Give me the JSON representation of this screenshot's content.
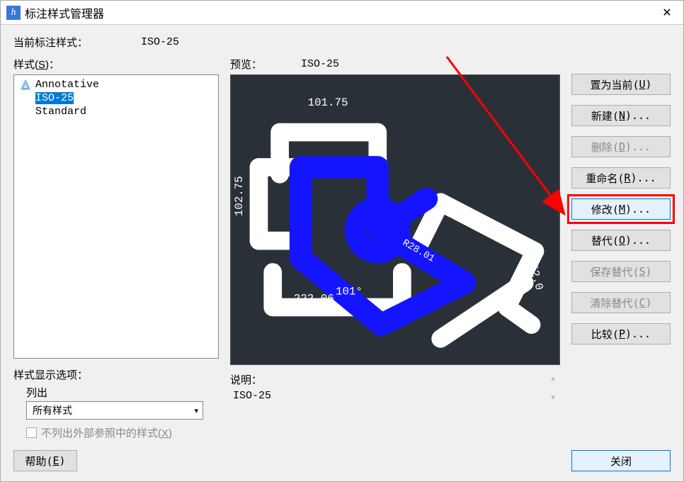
{
  "window": {
    "title": "标注样式管理器",
    "icon_glyph": "h"
  },
  "current_style": {
    "label": "当前标注样式：",
    "value": "ISO-25"
  },
  "styles": {
    "label_prefix": "样式(",
    "label_key": "S",
    "label_suffix": ")：",
    "items": [
      {
        "name": "Annotative",
        "selected": false,
        "has_icon": true
      },
      {
        "name": "ISO-25",
        "selected": true,
        "has_icon": false
      },
      {
        "name": "Standard",
        "selected": false,
        "has_icon": false
      }
    ]
  },
  "display_options": {
    "header": "样式显示选项：",
    "list_label": "列出",
    "combo_value": "所有样式",
    "hide_xref_prefix": "不列出外部参照中的样式(",
    "hide_xref_key": "X",
    "hide_xref_suffix": ")"
  },
  "preview": {
    "label": "预览：",
    "style_name": "ISO-25"
  },
  "description": {
    "label": "说明：",
    "value": "ISO-25"
  },
  "buttons": {
    "set_current": {
      "pre": "置为当前(",
      "key": "U",
      "post": ")"
    },
    "new": {
      "pre": "新建(",
      "key": "N",
      "post": ")..."
    },
    "delete": {
      "pre": "删除(",
      "key": "D",
      "post": ")..."
    },
    "rename": {
      "pre": "重命名(",
      "key": "R",
      "post": ")..."
    },
    "modify": {
      "pre": "修改(",
      "key": "M",
      "post": ")..."
    },
    "override": {
      "pre": "替代(",
      "key": "O",
      "post": ")..."
    },
    "save_ov": {
      "pre": "保存替代(",
      "key": "S",
      "post": ")"
    },
    "clear_ov": {
      "pre": "清除替代(",
      "key": "C",
      "post": ")"
    },
    "compare": {
      "pre": "比较(",
      "key": "P",
      "post": ")..."
    },
    "help": {
      "pre": "帮助(",
      "key": "E",
      "post": ")"
    },
    "close": "关闭"
  },
  "preview_dim_texts": {
    "top": "101.75",
    "left": "102.75",
    "bottom": "222.06",
    "angle": "101°",
    "right1": "152.0",
    "right2": "R28.01"
  }
}
